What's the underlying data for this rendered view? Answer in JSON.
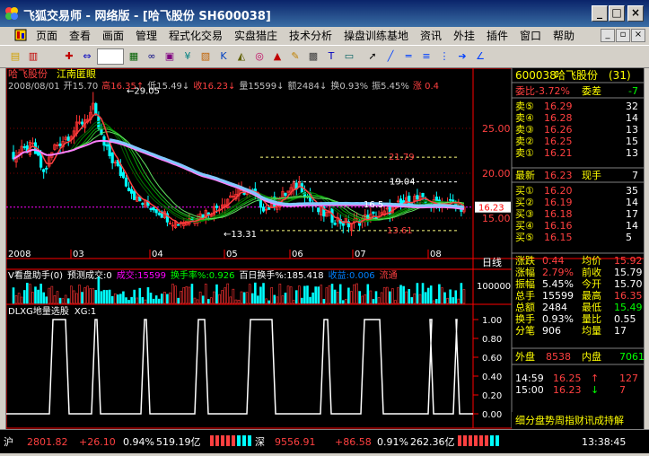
{
  "window": {
    "title": "飞狐交易师 - 网络版 - [哈飞股份 SH600038]",
    "minimize": "_",
    "maximize": "□",
    "close": "×",
    "mdi_min": "_",
    "mdi_restore": "▫",
    "mdi_close": "×"
  },
  "menu": [
    "页面",
    "查看",
    "画面",
    "管理",
    "程式化交易",
    "实盘猎庄",
    "技术分析",
    "操盘训练基地",
    "资讯",
    "外挂",
    "插件",
    "窗口",
    "帮助"
  ],
  "toolbar": {
    "rsi": "RSI",
    "period_label": "权",
    "icons": [
      "folder-icon",
      "bar-chart-icon",
      "rsi-icon",
      "cross-icon",
      "arrows-icon",
      "weight-icon",
      "grid-icon",
      "glasses-icon",
      "table-icon",
      "money-icon",
      "chart-icon",
      "k-icon",
      "mountain-icon",
      "target-icon",
      "bell-icon",
      "pen-icon",
      "chip-icon",
      "text-icon",
      "layout-icon",
      "cursor-icon",
      "line-icon",
      "hline-icon",
      "channel-icon",
      "fib-icon",
      "arrow-icon",
      "gann-icon"
    ]
  },
  "stock": {
    "name": "哈飞股份",
    "concept": "江南匿眼",
    "date": "2008/08/01",
    "open_label": "开",
    "open": "15.70",
    "high_label": "高",
    "high": "16.35",
    "low_label": "低",
    "low": "15.49",
    "close_label": "收",
    "close": "16.23",
    "vol_label": "量",
    "vol": "15599",
    "amt_label": "额",
    "amt": "2484",
    "turn_label": "换",
    "turn": "0.93%",
    "amp_label": "振",
    "amp": "5.45%",
    "chg_label": "涨",
    "chg": "0.4"
  },
  "price_axis": {
    "labels": [
      "25.00",
      "20.00",
      "15.00"
    ],
    "current": "16.23"
  },
  "annotations": {
    "peak": "29.05",
    "low": "13.31",
    "red1": "21.79",
    "white1": "19.04",
    "red2": "13.61",
    "mid": "16.5"
  },
  "time_axis": {
    "labels": [
      "2008",
      "03",
      "04",
      "05",
      "06",
      "07",
      "08"
    ],
    "period": "日线"
  },
  "volume_panel": {
    "name": "V看盘助手(0)",
    "items": [
      {
        "label": "预测成交:",
        "value": "0",
        "color": "#ffffff"
      },
      {
        "label": "成交:",
        "value": "15599",
        "color": "#ff00ff"
      },
      {
        "label": "换手率%:",
        "value": "0.926",
        "color": "#00ff00"
      },
      {
        "label": "百日换手%:",
        "value": "185.418",
        "color": "#ffffff"
      },
      {
        "label": "收益:",
        "value": "0.006",
        "color": "#0080ff"
      },
      {
        "label": "流通",
        "value": "",
        "color": "#ff4040"
      }
    ],
    "axis": "100000"
  },
  "indicator_panel": {
    "name": "DLXG地量选股",
    "param": "XG:1",
    "axis": [
      "1.00",
      "0.80",
      "0.60",
      "0.40",
      "0.20",
      "0.00"
    ]
  },
  "quote": {
    "code": "600038",
    "name": "哈飞股份",
    "num": "(31)",
    "weibi_label": "委比",
    "weibi": "-3.72%",
    "weicha_label": "委差",
    "weicha": "-7",
    "sells": [
      {
        "label": "卖⑤",
        "price": "16.29",
        "vol": "32"
      },
      {
        "label": "卖④",
        "price": "16.28",
        "vol": "14"
      },
      {
        "label": "卖③",
        "price": "16.26",
        "vol": "13"
      },
      {
        "label": "卖②",
        "price": "16.25",
        "vol": "15"
      },
      {
        "label": "卖①",
        "price": "16.21",
        "vol": "13"
      }
    ],
    "last_label": "最新",
    "last": "16.23",
    "xianshou_label": "现手",
    "xianshou": "7",
    "buys": [
      {
        "label": "买①",
        "price": "16.20",
        "vol": "35"
      },
      {
        "label": "买②",
        "price": "16.19",
        "vol": "14"
      },
      {
        "label": "买③",
        "price": "16.18",
        "vol": "17"
      },
      {
        "label": "买④",
        "price": "16.16",
        "vol": "14"
      },
      {
        "label": "买⑤",
        "price": "16.15",
        "vol": "5"
      }
    ],
    "stats": [
      {
        "l1": "涨跌",
        "v1": "0.44",
        "l2": "均价",
        "v2": "15.92"
      },
      {
        "l1": "涨幅",
        "v1": "2.79%",
        "l2": "前收",
        "v2": "15.79"
      },
      {
        "l1": "振幅",
        "v1": "5.45%",
        "l2": "今开",
        "v2": "15.70"
      },
      {
        "l1": "总手",
        "v1": "15599",
        "l2": "最高",
        "v2": "16.35"
      },
      {
        "l1": "总额",
        "v1": "2484",
        "l2": "最低",
        "v2": "15.49"
      },
      {
        "l1": "换手",
        "v1": "0.93%",
        "l2": "量比",
        "v2": "0.55"
      },
      {
        "l1": "分笔",
        "v1": "906",
        "l2": "均量",
        "v2": "17"
      }
    ],
    "outer_label": "外盘",
    "outer": "8538",
    "inner_label": "内盘",
    "inner": "7061",
    "ticks": [
      {
        "time": "14:59",
        "price": "16.25",
        "dir": "↑",
        "vol": "127"
      },
      {
        "time": "15:00",
        "price": "16.23",
        "dir": "↓",
        "vol": "7"
      }
    ],
    "footer": "细分盘势周指财讯成持解"
  },
  "status": {
    "sh_label": "沪",
    "sh_index": "2801.82",
    "sh_chg": "+26.10",
    "sh_pct": "0.94%",
    "sh_amt": "519.19亿",
    "sz_label": "深",
    "sz_index": "9556.91",
    "sz_chg": "+86.58",
    "sz_pct": "0.91%",
    "sz_amt": "262.36亿",
    "time": "13:38:45"
  },
  "colors": {
    "up": "#ff3232",
    "down": "#00ffff",
    "axis": "#ff0000",
    "text_yellow": "#ffff00",
    "ma_white": "#ffffff",
    "ma_magenta": "#ff80ff",
    "ma_cyan": "#80c8ff",
    "ma_green": "#00c000"
  }
}
